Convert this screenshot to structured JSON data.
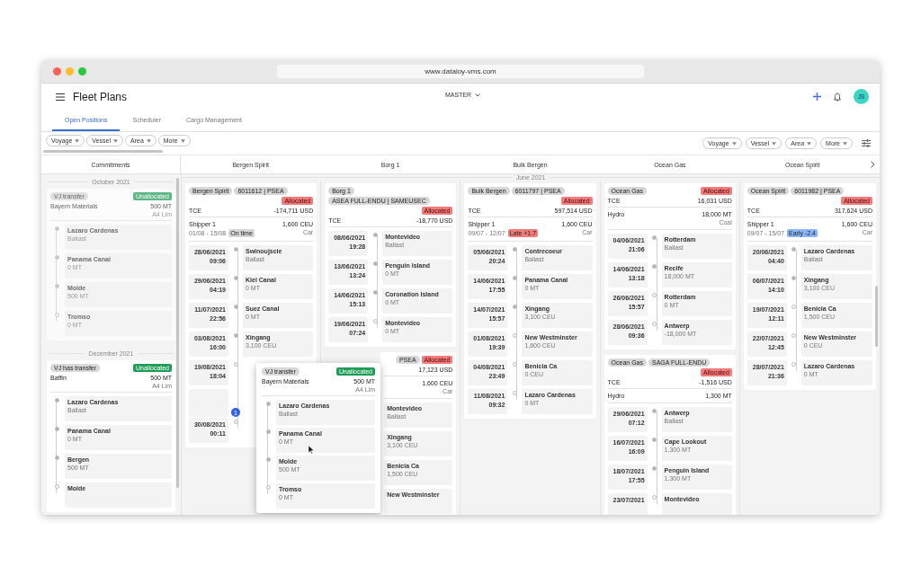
{
  "browser": {
    "url": "www.dataloy-vms.com"
  },
  "header": {
    "title": "Fleet Plans",
    "plan": "MASTER",
    "avatar": "JS"
  },
  "tabs": [
    {
      "label": "Open Positions",
      "selected": true
    },
    {
      "label": "Scheduler",
      "selected": false
    },
    {
      "label": "Cargo Management",
      "selected": false
    }
  ],
  "filters_left": [
    "Voyage",
    "Vessel",
    "Area",
    "More"
  ],
  "filters_right": [
    "Voyage",
    "Vessel",
    "Area",
    "More"
  ],
  "commitments": {
    "title": "Commitments",
    "groups": [
      {
        "month": "October 2021",
        "items": [
          {
            "tag": "VJ transfer",
            "status": {
              "text": "Unallocated",
              "kind": "unallocated"
            },
            "cargo": "Bayern Materials",
            "qty": "500 MT",
            "terms": "A4 Lim",
            "dragging": true,
            "stops": [
              {
                "name": "Lazaro Cardenas",
                "detail": "Ballast",
                "done": true
              },
              {
                "name": "Panama Canal",
                "detail": "0 MT",
                "done": true
              },
              {
                "name": "Molde",
                "detail": "500 MT",
                "done": true
              },
              {
                "name": "Tromso",
                "detail": "0 MT",
                "done": false
              }
            ]
          }
        ]
      },
      {
        "month": "December 2021",
        "items": [
          {
            "tag": "VJ has transfer",
            "status": {
              "text": "Unallocated",
              "kind": "unallocated"
            },
            "cargo": "Baffin",
            "qty": "500 MT",
            "terms": "A4 Lim",
            "dragging": false,
            "stops": [
              {
                "name": "Lazaro Cardenas",
                "detail": "Ballast",
                "done": true
              },
              {
                "name": "Panama Canal",
                "detail": "0 MT",
                "done": true
              },
              {
                "name": "Bergen",
                "detail": "500 MT",
                "done": true
              },
              {
                "name": "Molde",
                "done": false
              }
            ]
          }
        ]
      }
    ]
  },
  "board": {
    "month": "June 2021",
    "columns": [
      {
        "vessel": "Bergen Spirit",
        "cards": [
          {
            "tags": [
              "Bergen Spirit",
              "6011612 | PSEA"
            ],
            "status": {
              "text": "Allocated",
              "kind": "allocated"
            },
            "tce": {
              "label": "TCE",
              "value": "-174,711 USD"
            },
            "cargo": {
              "shipper": "Shipper 1",
              "qty": "1,600 CEU",
              "window": "01/08 - 15/08",
              "timing": {
                "text": "On time",
                "kind": "on_time"
              },
              "type": "Car"
            },
            "stops": [
              {
                "date": "28/06/2021",
                "time": "09:06",
                "name": "Swinoujscie",
                "detail": "Ballast",
                "done": true
              },
              {
                "date": "29/06/2021",
                "time": "04:19",
                "name": "Kiel Canal",
                "detail": "0 MT",
                "done": true
              },
              {
                "date": "11/07/2021",
                "time": "22:56",
                "name": "Suez Canal",
                "detail": "0 MT",
                "done": true
              },
              {
                "date": "03/08/2021",
                "time": "16:00",
                "name": "Xingang",
                "detail": "3,100 CEU",
                "done": true
              },
              {
                "date": "19/08/2021",
                "time": "18:04",
                "done": false
              },
              {
                "marker": "1"
              },
              {
                "date": "30/08/2021",
                "time": "00:11",
                "done": false
              }
            ]
          }
        ]
      },
      {
        "vessel": "Borg 1",
        "cards": [
          {
            "tags": [
              "Borg 1",
              "ASEA FULL-ENDU | SAMEUSEC"
            ],
            "status": {
              "text": "Allocated",
              "kind": "allocated"
            },
            "tce": {
              "label": "TCE",
              "value": "-18,770 USD"
            },
            "stops": [
              {
                "date": "08/06/2021",
                "time": "19:28",
                "name": "Montevideo",
                "detail": "Ballast",
                "done": true
              },
              {
                "date": "13/06/2021",
                "time": "13:24",
                "name": "Penguin Island",
                "detail": "0 MT",
                "done": true
              },
              {
                "date": "14/06/2021",
                "time": "15:13",
                "name": "Coronation Island",
                "detail": "0 MT",
                "done": true
              },
              {
                "date": "19/06/2021",
                "time": "07:24",
                "name": "Montevideo",
                "detail": "0 MT",
                "done": false
              }
            ]
          },
          {
            "obscured": true,
            "tags": [
              "PSEA"
            ],
            "status": {
              "text": "Allocated",
              "kind": "allocated"
            },
            "tce": {
              "value": "17,123 USD"
            },
            "cargo": {
              "qty": "1,600 CEU",
              "type": "Car"
            },
            "stops": [
              {
                "name": "Montevideo",
                "detail": "Ballast"
              },
              {
                "name": "Xingang",
                "detail": "3,100 CEU"
              },
              {
                "name": "Benicia Ca",
                "detail": "1,500 CEU"
              },
              {
                "name": "New Westminster"
              }
            ]
          }
        ]
      },
      {
        "vessel": "Bulk Bergen",
        "cards": [
          {
            "tags": [
              "Bulk Bergen",
              "6011797 | PSEA"
            ],
            "status": {
              "text": "Allocated",
              "kind": "allocated"
            },
            "tce": {
              "label": "TCE",
              "value": "597,514 USD"
            },
            "cargo": {
              "shipper": "Shipper 1",
              "qty": "1,600 CEU",
              "window": "09/07 - 12/07",
              "timing": {
                "text": "Late +1.7",
                "kind": "late"
              },
              "type": "Car"
            },
            "stops": [
              {
                "date": "05/06/2021",
                "time": "20:24",
                "name": "Contrecoeur",
                "detail": "Ballast",
                "done": true
              },
              {
                "date": "14/06/2021",
                "time": "17:55",
                "name": "Panama Canal",
                "detail": "0 MT",
                "done": true
              },
              {
                "date": "14/07/2021",
                "time": "15:57",
                "name": "Xingang",
                "detail": "3,100 CEU",
                "done": true
              },
              {
                "date": "01/08/2021",
                "time": "19:39",
                "name": "New Westminster",
                "detail": "1,600 CEU",
                "done": false
              },
              {
                "date": "04/08/2021",
                "time": "23:49",
                "name": "Benicia Ca",
                "detail": "0 CEU",
                "done": false
              },
              {
                "date": "11/08/2021",
                "time": "09:32",
                "name": "Lazaro Cardenas",
                "detail": "0 MT",
                "done": false
              }
            ]
          }
        ]
      },
      {
        "vessel": "Ocean Gas",
        "cards": [
          {
            "tags": [
              "Ocean Gas"
            ],
            "status": {
              "text": "Allocated",
              "kind": "allocated"
            },
            "tce": {
              "label": "TCE",
              "value": "16,031 USD"
            },
            "cargo": {
              "shipper": "Hydro",
              "qty": "18,000 MT",
              "type": "Coal"
            },
            "stops": [
              {
                "date": "04/06/2021",
                "time": "21:06",
                "name": "Rotterdam",
                "detail": "Ballast",
                "done": true
              },
              {
                "date": "14/06/2021",
                "time": "13:18",
                "name": "Recife",
                "detail": "18,000 MT",
                "done": true
              },
              {
                "date": "26/06/2021",
                "time": "15:57",
                "name": "Rotterdam",
                "detail": "0 MT",
                "done": false
              },
              {
                "date": "28/06/2021",
                "time": "09:36",
                "name": "Antwerp",
                "detail": "-18,000 MT",
                "done": false
              }
            ]
          },
          {
            "tags": [
              "Ocean Gas",
              "SAGA FULL-ENDU"
            ],
            "status": {
              "text": "Allocated",
              "kind": "allocated"
            },
            "tce": {
              "label": "TCE",
              "value": "-1,516 USD"
            },
            "cargo": {
              "shipper": "Hydro",
              "qty": "1,300 MT"
            },
            "stops": [
              {
                "date": "29/06/2021",
                "time": "07:12",
                "name": "Antwerp",
                "detail": "Ballast",
                "done": true
              },
              {
                "date": "16/07/2021",
                "time": "16:09",
                "name": "Cape Lookout",
                "detail": "1,300 MT",
                "done": true
              },
              {
                "date": "18/07/2021",
                "time": "17:55",
                "name": "Penguin Island",
                "detail": "1,300 MT",
                "done": true
              },
              {
                "date": "23/07/2021",
                "name": "Montevideo",
                "done": false
              }
            ]
          }
        ]
      },
      {
        "vessel": "Ocean Spirit",
        "cards": [
          {
            "tags": [
              "Ocean Spirit",
              "6011982 | PSEA"
            ],
            "status": {
              "text": "Allocated",
              "kind": "allocated"
            },
            "tce": {
              "label": "TCE",
              "value": "317,624 USD"
            },
            "cargo": {
              "shipper": "Shipper 1",
              "qty": "1,600 CEU",
              "window": "09/07 - 15/07",
              "timing": {
                "text": "Early -2.4",
                "kind": "early"
              },
              "type": "Car"
            },
            "stops": [
              {
                "date": "20/06/2021",
                "time": "04:40",
                "name": "Lazaro Cardenas",
                "detail": "Ballast",
                "done": true
              },
              {
                "date": "06/07/2021",
                "time": "14:10",
                "name": "Xingang",
                "detail": "3,100 CEU",
                "done": true
              },
              {
                "date": "19/07/2021",
                "time": "12:11",
                "name": "Benicia Ca",
                "detail": "1,500 CEU",
                "done": false
              },
              {
                "date": "22/07/2021",
                "time": "12:45",
                "name": "New Westminster",
                "detail": "0 CEU",
                "done": false
              },
              {
                "date": "28/07/2021",
                "time": "21:36",
                "name": "Lazaro Cardenas",
                "detail": "0 MT",
                "done": false
              }
            ]
          }
        ]
      }
    ]
  },
  "drag_preview": {
    "tag": "VJ transfer",
    "status": {
      "text": "Unallocated",
      "kind": "unallocated"
    },
    "cargo": "Bayern Materials",
    "qty": "500 MT",
    "terms": "A4 Lim",
    "stops": [
      {
        "name": "Lazaro Cardenas",
        "detail": "Ballast",
        "done": true
      },
      {
        "name": "Panama Canal",
        "detail": "0 MT",
        "done": true
      },
      {
        "name": "Molde",
        "detail": "500 MT",
        "done": true
      },
      {
        "name": "Tromso",
        "detail": "0 MT",
        "done": false
      }
    ]
  }
}
